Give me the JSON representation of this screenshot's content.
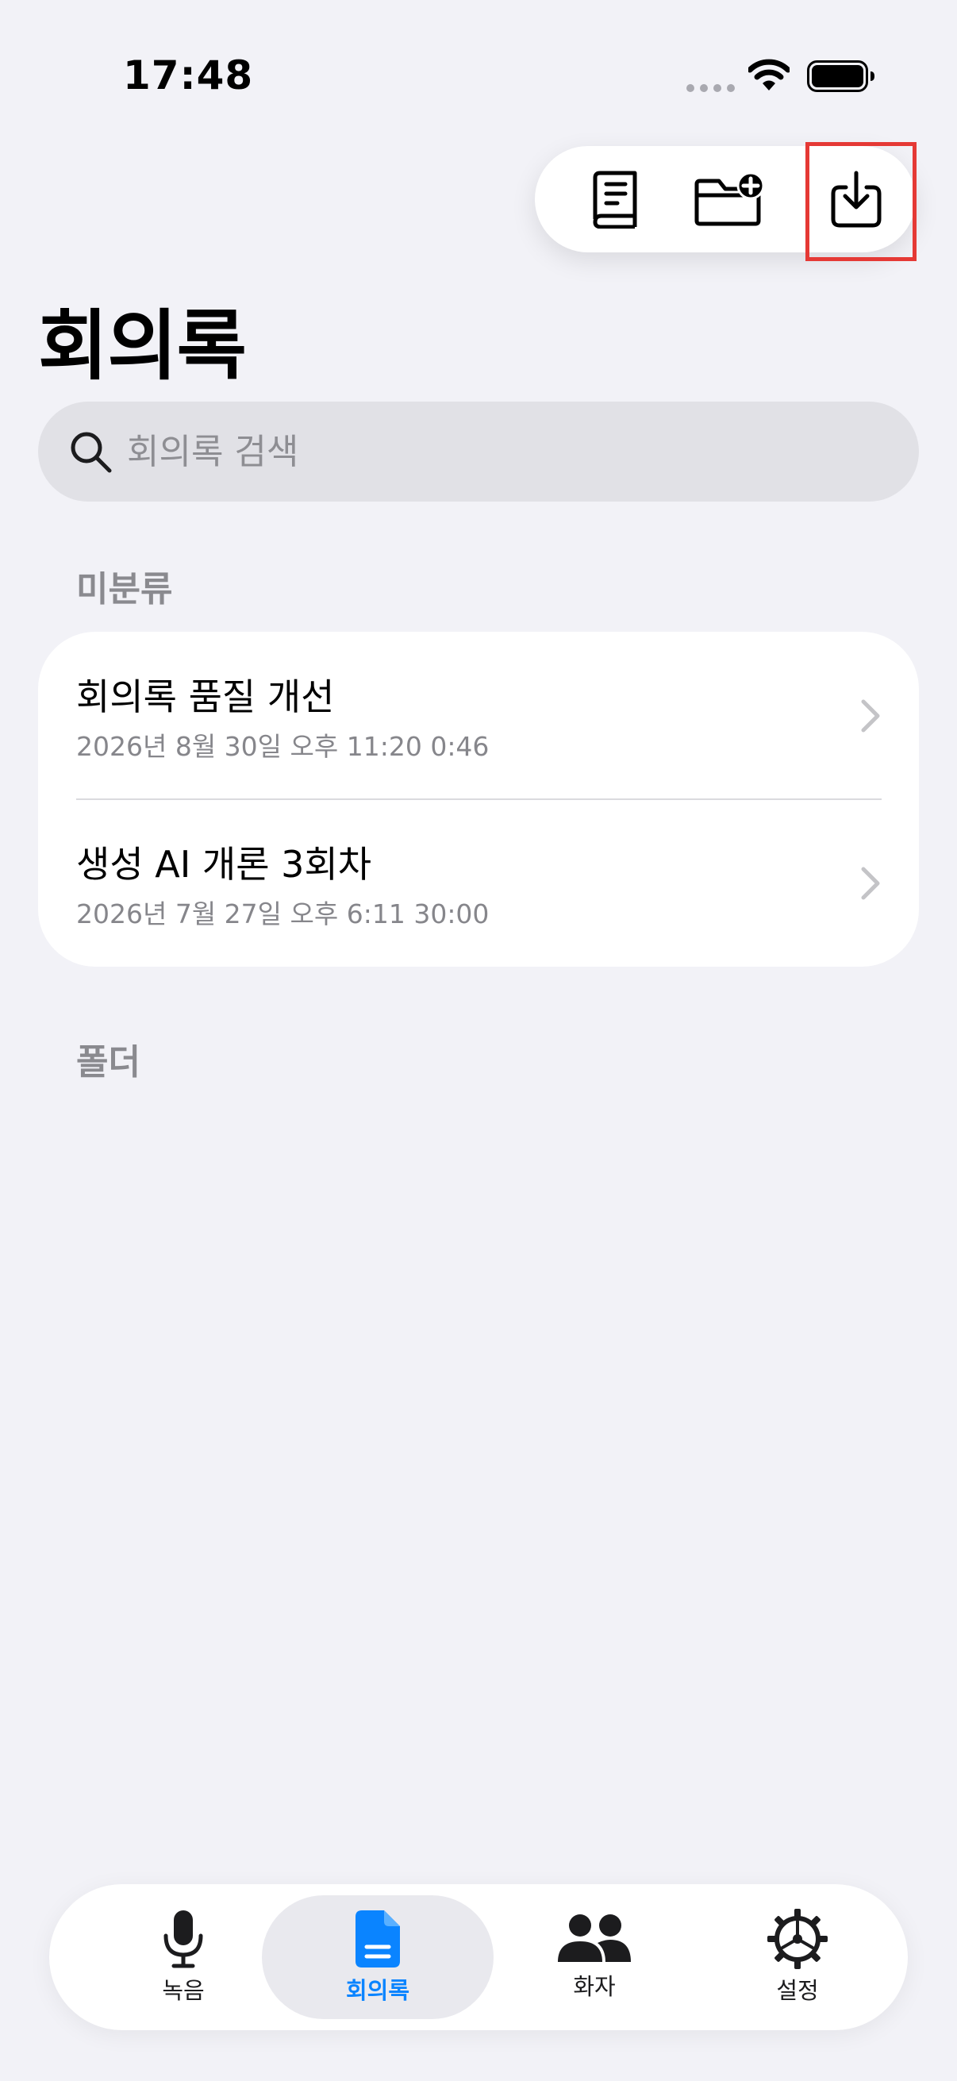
{
  "status_bar": {
    "time": "17:48"
  },
  "toolbar": {
    "icons": [
      "book-icon",
      "folder-add-icon",
      "import-icon"
    ],
    "highlight_color": "#E53935"
  },
  "page": {
    "title": "회의록"
  },
  "search": {
    "placeholder": "회의록 검색"
  },
  "sections": {
    "uncategorized": "미분류",
    "folders": "폴더"
  },
  "recordings": [
    {
      "title": "회의록 품질 개선",
      "subtitle": "2026년 8월 30일 오후 11:20   0:46"
    },
    {
      "title": "생성 AI 개론 3회차",
      "subtitle": "2026년 7월 27일 오후 6:11   30:00"
    }
  ],
  "tabbar": {
    "active_color": "#0A84FF",
    "active": "회의록",
    "items": [
      {
        "label": "녹음",
        "icon": "microphone-icon"
      },
      {
        "label": "회의록",
        "icon": "document-icon"
      },
      {
        "label": "화자",
        "icon": "people-icon"
      },
      {
        "label": "설정",
        "icon": "gear-icon"
      }
    ]
  }
}
